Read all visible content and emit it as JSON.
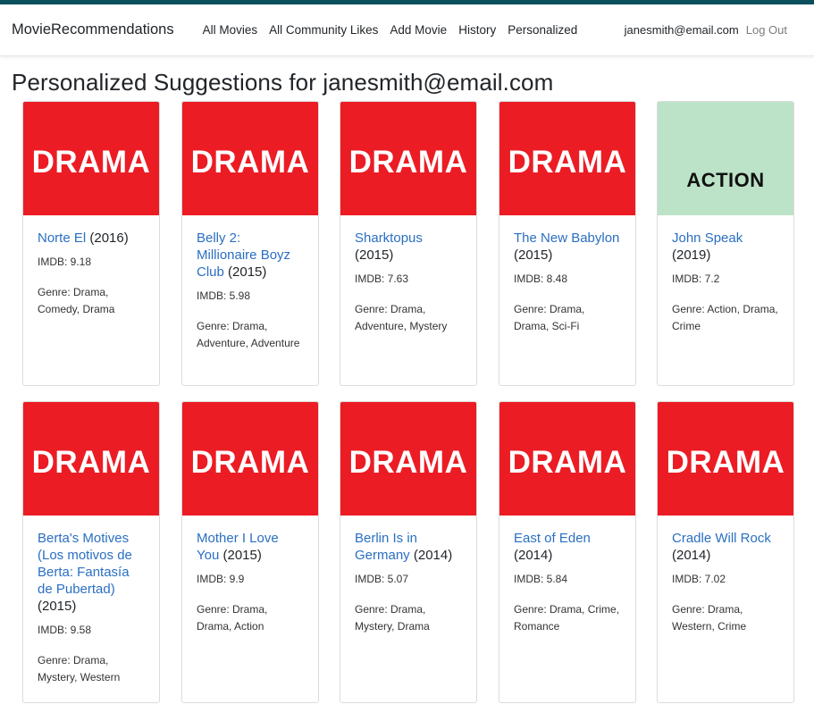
{
  "navbar": {
    "brand": "MovieRecommendations",
    "links": [
      "All Movies",
      "All Community Likes",
      "Add Movie",
      "History",
      "Personalized"
    ],
    "user_email": "janesmith@email.com",
    "logout": "Log Out"
  },
  "page": {
    "title": "Personalized Suggestions for janesmith@email.com"
  },
  "movies": [
    {
      "banner": "DRAMA",
      "title": "Norte El",
      "year": "(2016)",
      "imdb": "IMDB: 9.18",
      "genre": "Genre: Drama, Comedy, Drama"
    },
    {
      "banner": "DRAMA",
      "title": "Belly 2: Millionaire Boyz Club",
      "year": "(2015)",
      "imdb": "IMDB: 5.98",
      "genre": "Genre: Drama, Adventure, Adventure"
    },
    {
      "banner": "DRAMA",
      "title": "Sharktopus",
      "year": "(2015)",
      "imdb": "IMDB: 7.63",
      "genre": "Genre: Drama, Adventure, Mystery"
    },
    {
      "banner": "DRAMA",
      "title": "The New Babylon",
      "year": "(2015)",
      "imdb": "IMDB: 8.48",
      "genre": "Genre: Drama, Drama, Sci-Fi"
    },
    {
      "banner": "ACTION",
      "title": "John Speak",
      "year": "(2019)",
      "imdb": "IMDB: 7.2",
      "genre": "Genre: Action, Drama, Crime"
    },
    {
      "banner": "DRAMA",
      "title": "Berta's Motives (Los motivos de Berta: Fantasía de Pubertad)",
      "year": "(2015)",
      "imdb": "IMDB: 9.58",
      "genre": "Genre: Drama, Mystery, Western"
    },
    {
      "banner": "DRAMA",
      "title": "Mother I Love You",
      "year": "(2015)",
      "imdb": "IMDB: 9.9",
      "genre": "Genre: Drama, Drama, Action"
    },
    {
      "banner": "DRAMA",
      "title": "Berlin Is in Germany",
      "year": "(2014)",
      "imdb": "IMDB: 5.07",
      "genre": "Genre: Drama, Mystery, Drama"
    },
    {
      "banner": "DRAMA",
      "title": "East of Eden",
      "year": "(2014)",
      "imdb": "IMDB: 5.84",
      "genre": "Genre: Drama, Crime, Romance"
    },
    {
      "banner": "DRAMA",
      "title": "Cradle Will Rock",
      "year": "(2014)",
      "imdb": "IMDB: 7.02",
      "genre": "Genre: Drama, Western, Crime"
    }
  ],
  "colors": {
    "drama_banner": "#ec1c24",
    "action_banner": "#bce3c7",
    "link": "#2a6fc2",
    "top_accent": "#0b4f5c"
  }
}
